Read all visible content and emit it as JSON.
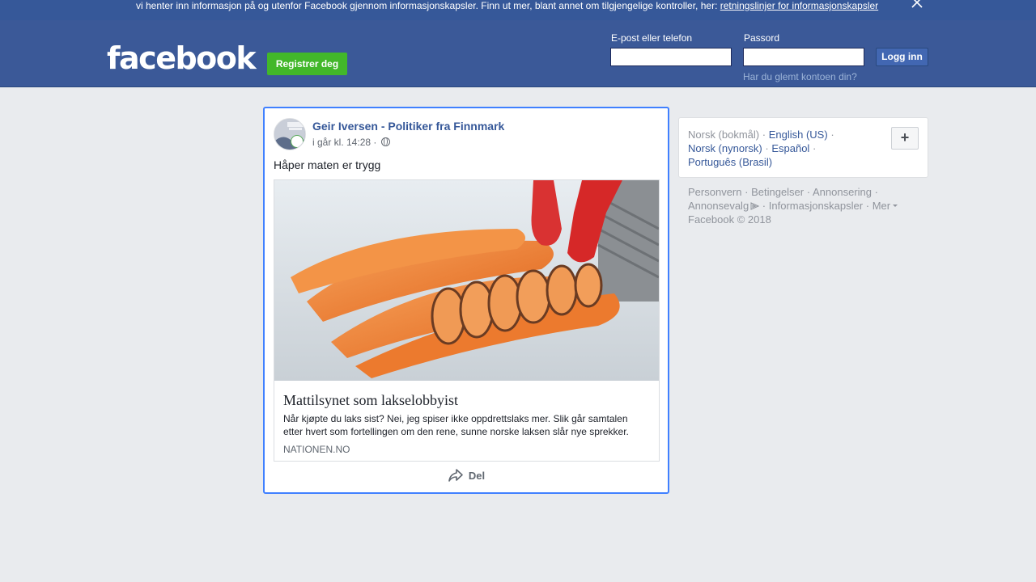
{
  "cookie_banner": {
    "text": "vi henter inn informasjon på og utenfor Facebook gjennom informasjonskapsler. Finn ut mer, blant annet om tilgjengelige kontroller, her: ",
    "link": "retningslinjer for informasjonskapsler",
    "close_icon": "close-icon"
  },
  "header": {
    "logo": "facebook",
    "register_label": "Registrer deg",
    "email_label": "E-post eller telefon",
    "email_value": "",
    "password_label": "Passord",
    "password_value": "",
    "login_label": "Logg inn",
    "forgot_label": "Har du glemt kontoen din?"
  },
  "post": {
    "author": "Geir Iversen - Politiker fra Finnmark",
    "time": "i går kl. 14:28",
    "meta_sep": "·",
    "privacy_icon": "globe-icon",
    "text": "Håper maten er trygg",
    "link": {
      "title": "Mattilsynet som lakselobbyist",
      "description": "Når kjøpte du laks sist? Nei, jeg spiser ikke oppdrettslaks mer. Slik går samtalen etter hvert som fortellingen om den rene, sunne norske laksen slår nye sprekker.",
      "domain": "NATIONEN.NO"
    },
    "share_label": "Del",
    "share_icon": "share-icon"
  },
  "languages": {
    "current": "Norsk (bokmål)",
    "english": "English (US)",
    "nynorsk": "Norsk (nynorsk)",
    "espanol": "Español",
    "portugues": "Português (Brasil)",
    "sep": "·",
    "add_label": "+"
  },
  "footer": {
    "personvern": "Personvern",
    "betingelser": "Betingelser",
    "annonsering": "Annonsering",
    "annonsevalg": "Annonsevalg",
    "informasjonskapsler": "Informasjonskapsler",
    "mer": "Mer",
    "copyright": "Facebook © 2018",
    "sep": "·"
  },
  "colors": {
    "brand_blue": "#3b5998",
    "link_blue": "#365899",
    "register_green": "#42b72a",
    "focus_border": "#4080ff"
  }
}
